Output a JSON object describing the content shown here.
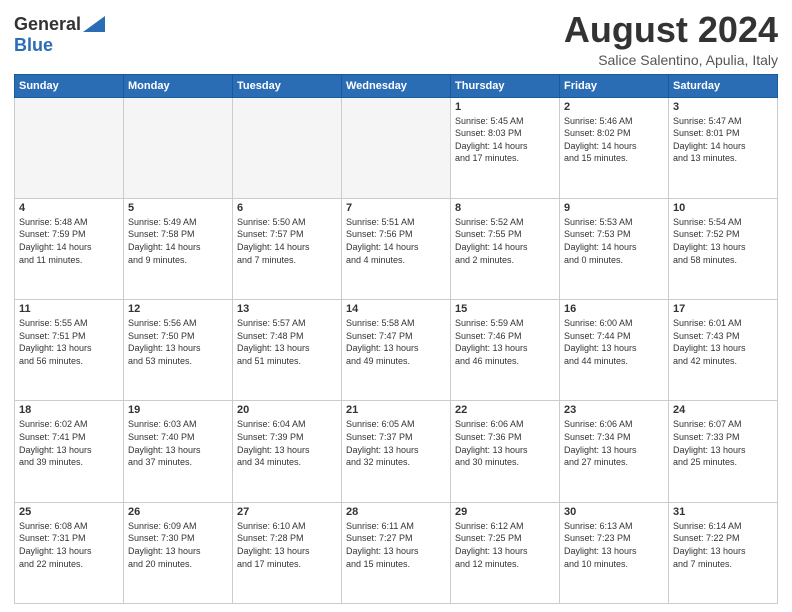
{
  "logo": {
    "line1": "General",
    "line2": "Blue"
  },
  "title": "August 2024",
  "location": "Salice Salentino, Apulia, Italy",
  "days_of_week": [
    "Sunday",
    "Monday",
    "Tuesday",
    "Wednesday",
    "Thursday",
    "Friday",
    "Saturday"
  ],
  "weeks": [
    [
      {
        "day": "",
        "info": ""
      },
      {
        "day": "",
        "info": ""
      },
      {
        "day": "",
        "info": ""
      },
      {
        "day": "",
        "info": ""
      },
      {
        "day": "1",
        "info": "Sunrise: 5:45 AM\nSunset: 8:03 PM\nDaylight: 14 hours\nand 17 minutes."
      },
      {
        "day": "2",
        "info": "Sunrise: 5:46 AM\nSunset: 8:02 PM\nDaylight: 14 hours\nand 15 minutes."
      },
      {
        "day": "3",
        "info": "Sunrise: 5:47 AM\nSunset: 8:01 PM\nDaylight: 14 hours\nand 13 minutes."
      }
    ],
    [
      {
        "day": "4",
        "info": "Sunrise: 5:48 AM\nSunset: 7:59 PM\nDaylight: 14 hours\nand 11 minutes."
      },
      {
        "day": "5",
        "info": "Sunrise: 5:49 AM\nSunset: 7:58 PM\nDaylight: 14 hours\nand 9 minutes."
      },
      {
        "day": "6",
        "info": "Sunrise: 5:50 AM\nSunset: 7:57 PM\nDaylight: 14 hours\nand 7 minutes."
      },
      {
        "day": "7",
        "info": "Sunrise: 5:51 AM\nSunset: 7:56 PM\nDaylight: 14 hours\nand 4 minutes."
      },
      {
        "day": "8",
        "info": "Sunrise: 5:52 AM\nSunset: 7:55 PM\nDaylight: 14 hours\nand 2 minutes."
      },
      {
        "day": "9",
        "info": "Sunrise: 5:53 AM\nSunset: 7:53 PM\nDaylight: 14 hours\nand 0 minutes."
      },
      {
        "day": "10",
        "info": "Sunrise: 5:54 AM\nSunset: 7:52 PM\nDaylight: 13 hours\nand 58 minutes."
      }
    ],
    [
      {
        "day": "11",
        "info": "Sunrise: 5:55 AM\nSunset: 7:51 PM\nDaylight: 13 hours\nand 56 minutes."
      },
      {
        "day": "12",
        "info": "Sunrise: 5:56 AM\nSunset: 7:50 PM\nDaylight: 13 hours\nand 53 minutes."
      },
      {
        "day": "13",
        "info": "Sunrise: 5:57 AM\nSunset: 7:48 PM\nDaylight: 13 hours\nand 51 minutes."
      },
      {
        "day": "14",
        "info": "Sunrise: 5:58 AM\nSunset: 7:47 PM\nDaylight: 13 hours\nand 49 minutes."
      },
      {
        "day": "15",
        "info": "Sunrise: 5:59 AM\nSunset: 7:46 PM\nDaylight: 13 hours\nand 46 minutes."
      },
      {
        "day": "16",
        "info": "Sunrise: 6:00 AM\nSunset: 7:44 PM\nDaylight: 13 hours\nand 44 minutes."
      },
      {
        "day": "17",
        "info": "Sunrise: 6:01 AM\nSunset: 7:43 PM\nDaylight: 13 hours\nand 42 minutes."
      }
    ],
    [
      {
        "day": "18",
        "info": "Sunrise: 6:02 AM\nSunset: 7:41 PM\nDaylight: 13 hours\nand 39 minutes."
      },
      {
        "day": "19",
        "info": "Sunrise: 6:03 AM\nSunset: 7:40 PM\nDaylight: 13 hours\nand 37 minutes."
      },
      {
        "day": "20",
        "info": "Sunrise: 6:04 AM\nSunset: 7:39 PM\nDaylight: 13 hours\nand 34 minutes."
      },
      {
        "day": "21",
        "info": "Sunrise: 6:05 AM\nSunset: 7:37 PM\nDaylight: 13 hours\nand 32 minutes."
      },
      {
        "day": "22",
        "info": "Sunrise: 6:06 AM\nSunset: 7:36 PM\nDaylight: 13 hours\nand 30 minutes."
      },
      {
        "day": "23",
        "info": "Sunrise: 6:06 AM\nSunset: 7:34 PM\nDaylight: 13 hours\nand 27 minutes."
      },
      {
        "day": "24",
        "info": "Sunrise: 6:07 AM\nSunset: 7:33 PM\nDaylight: 13 hours\nand 25 minutes."
      }
    ],
    [
      {
        "day": "25",
        "info": "Sunrise: 6:08 AM\nSunset: 7:31 PM\nDaylight: 13 hours\nand 22 minutes."
      },
      {
        "day": "26",
        "info": "Sunrise: 6:09 AM\nSunset: 7:30 PM\nDaylight: 13 hours\nand 20 minutes."
      },
      {
        "day": "27",
        "info": "Sunrise: 6:10 AM\nSunset: 7:28 PM\nDaylight: 13 hours\nand 17 minutes."
      },
      {
        "day": "28",
        "info": "Sunrise: 6:11 AM\nSunset: 7:27 PM\nDaylight: 13 hours\nand 15 minutes."
      },
      {
        "day": "29",
        "info": "Sunrise: 6:12 AM\nSunset: 7:25 PM\nDaylight: 13 hours\nand 12 minutes."
      },
      {
        "day": "30",
        "info": "Sunrise: 6:13 AM\nSunset: 7:23 PM\nDaylight: 13 hours\nand 10 minutes."
      },
      {
        "day": "31",
        "info": "Sunrise: 6:14 AM\nSunset: 7:22 PM\nDaylight: 13 hours\nand 7 minutes."
      }
    ]
  ]
}
